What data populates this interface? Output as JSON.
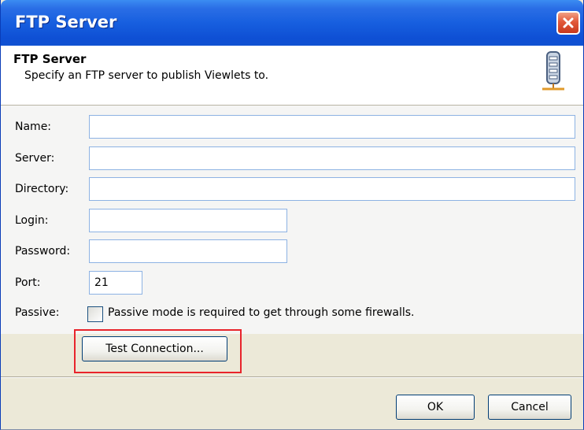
{
  "window": {
    "title": "FTP Server"
  },
  "header": {
    "title": "FTP Server",
    "description": "Specify an FTP server to publish Viewlets to.",
    "icon": "server-icon"
  },
  "form": {
    "name": {
      "label": "Name:",
      "value": ""
    },
    "server": {
      "label": "Server:",
      "value": ""
    },
    "directory": {
      "label": "Directory:",
      "value": ""
    },
    "login": {
      "label": "Login:",
      "value": ""
    },
    "password": {
      "label": "Password:",
      "value": ""
    },
    "port": {
      "label": "Port:",
      "value": "21"
    },
    "passive": {
      "label": "Passive:",
      "checkbox_label": "Passive mode is required to get through some firewalls.",
      "checked": false
    },
    "test_connection_label": "Test Connection..."
  },
  "buttons": {
    "ok": "OK",
    "cancel": "Cancel"
  },
  "colors": {
    "highlight": "#e8242b",
    "title_bar": "#175fdf"
  }
}
